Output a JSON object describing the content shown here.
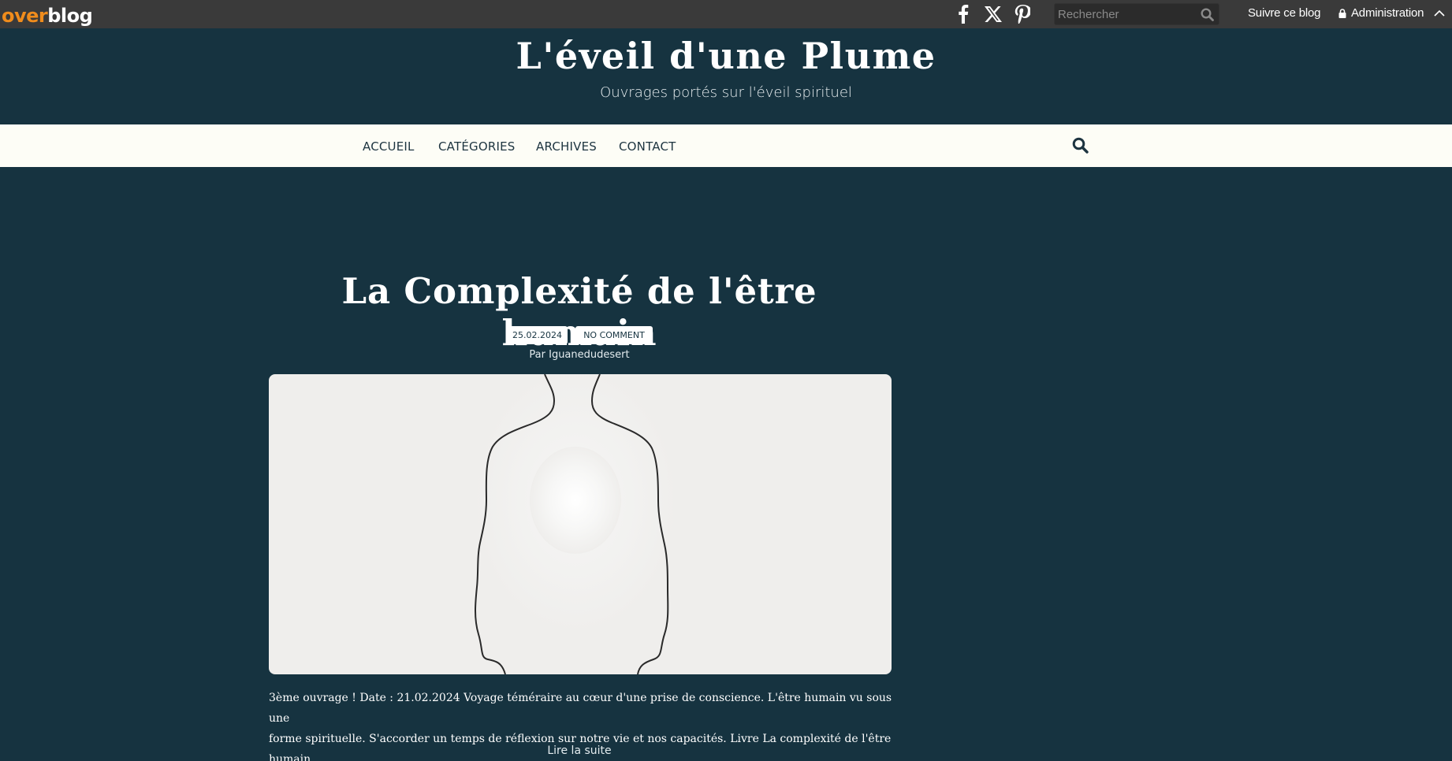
{
  "topbar": {
    "logo_over": "over",
    "logo_blog": "blog",
    "search_placeholder": "Rechercher",
    "follow_label": "Suivre ce blog",
    "admin_label": "Administration",
    "social_icons": [
      "facebook-icon",
      "x-twitter-icon",
      "pinterest-icon"
    ]
  },
  "header": {
    "title": "L'éveil d'une Plume",
    "subtitle": "Ouvrages portés sur l'éveil spirituel"
  },
  "nav": {
    "items": [
      "ACCUEIL",
      "CATÉGORIES",
      "ARCHIVES",
      "CONTACT"
    ]
  },
  "post": {
    "title": "La Complexité de l'être humain",
    "date": "25.02.2024",
    "comments": "NO COMMENT",
    "author_prefix": "Par",
    "author": "Iguanedudesert",
    "excerpt_line1": "3ème ouvrage ! Date : 21.02.2024 Voyage téméraire au cœur d'une prise de conscience. L'être humain vu sous une",
    "excerpt_line2": "forme spirituelle. S'accorder un temps de réflexion sur notre vie et nos capacités. Livre La complexité de l'être humain",
    "read_more": "Lire la suite"
  },
  "colors": {
    "page_background": "#163340",
    "topbar_background": "#3a3a3a",
    "nav_background": "#fdfdf6",
    "overblog_orange": "#f08c1c"
  }
}
